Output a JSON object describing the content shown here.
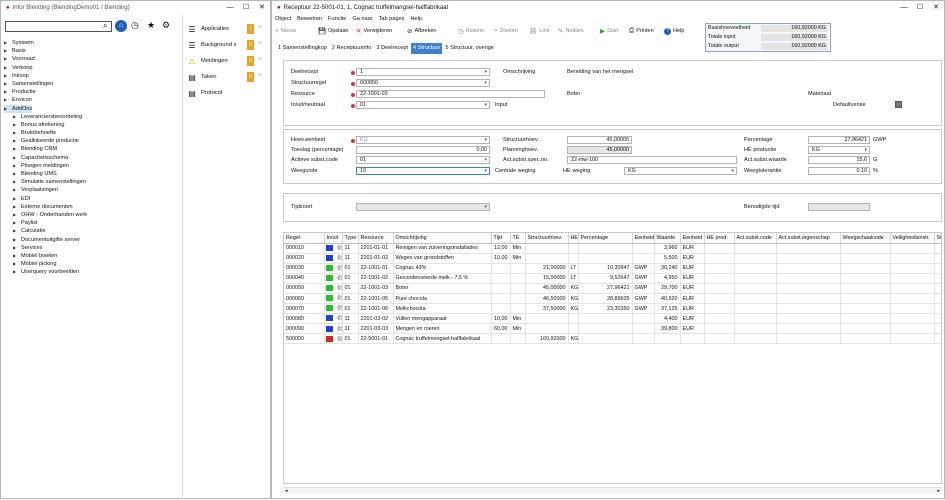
{
  "left": {
    "title": "Infor Blending (BlendingDemo01 / Blending)",
    "tree": [
      {
        "label": "Systeem",
        "level": 0,
        "sel": false
      },
      {
        "label": "Basis",
        "level": 0,
        "sel": false
      },
      {
        "label": "Voorraad",
        "level": 0,
        "sel": false
      },
      {
        "label": "Verkoop",
        "level": 0,
        "sel": false
      },
      {
        "label": "Inkoop",
        "level": 0,
        "sel": false
      },
      {
        "label": "Samenstellingen",
        "level": 0,
        "sel": false
      },
      {
        "label": "Productie",
        "level": 0,
        "sel": false
      },
      {
        "label": "Envicon",
        "level": 0,
        "sel": false
      },
      {
        "label": "AddOns",
        "level": 0,
        "sel": true
      },
      {
        "label": "Leveranciersbeoordeling",
        "level": 1,
        "sel": false
      },
      {
        "label": "Bonus afrekening",
        "level": 1,
        "sel": false
      },
      {
        "label": "Brutobehoefte",
        "level": 1,
        "sel": false
      },
      {
        "label": "Geallokeerde productie",
        "level": 1,
        "sel": false
      },
      {
        "label": "Blending CRM",
        "level": 1,
        "sel": false
      },
      {
        "label": "Capaciteitsschema",
        "level": 1,
        "sel": false
      },
      {
        "label": "Ploegen meldingen",
        "level": 1,
        "sel": false
      },
      {
        "label": "Blending UMS",
        "level": 1,
        "sel": false
      },
      {
        "label": "Simulatie samenstellingen",
        "level": 1,
        "sel": false
      },
      {
        "label": "Verplaatsingen",
        "level": 1,
        "sel": false
      },
      {
        "label": "EDI",
        "level": 1,
        "sel": false
      },
      {
        "label": "Externe documenten",
        "level": 1,
        "sel": false
      },
      {
        "label": "OHW - Onderhanden werk",
        "level": 1,
        "sel": false
      },
      {
        "label": "Paylist",
        "level": 1,
        "sel": false
      },
      {
        "label": "Calculatie",
        "level": 1,
        "sel": false
      },
      {
        "label": "Documentuitgifte server",
        "level": 1,
        "sel": false
      },
      {
        "label": "Services",
        "level": 1,
        "sel": false
      },
      {
        "label": "Mobiel boeken",
        "level": 1,
        "sel": false
      },
      {
        "label": "Mobiel picking",
        "level": 1,
        "sel": false
      },
      {
        "label": "Userquery voorbeelden",
        "level": 1,
        "sel": false
      }
    ],
    "panel": [
      {
        "label": "Applicaties",
        "count": "1",
        "icon": "list-icon"
      },
      {
        "label": "Background s",
        "count": "0",
        "icon": "list-icon"
      },
      {
        "label": "Meldingen",
        "count": "0",
        "icon": "warning-icon"
      },
      {
        "label": "Taken",
        "count": "0",
        "icon": "clipboard-icon"
      },
      {
        "label": "Protocol",
        "count": "",
        "icon": "clipboard-icon"
      }
    ]
  },
  "main": {
    "title": "Receptuur 22-5001-01, 1, Cognac truffelmangsel-halffabrikaat",
    "menu": [
      "Object",
      "Bewerken",
      "Functie",
      "Ga naar",
      "Tab pages",
      "Help"
    ],
    "toolbar": [
      {
        "label": "Nieuw",
        "icon": "+"
      },
      {
        "label": "Opslaan",
        "icon": "💾"
      },
      {
        "label": "Verwijderen",
        "icon": "✕"
      },
      {
        "label": "Afbreken",
        "icon": "⊘"
      },
      {
        "label": "Historie",
        "icon": "◷"
      },
      {
        "label": "Zoeken",
        "icon": "⌕"
      },
      {
        "label": "Link",
        "icon": "⛓"
      },
      {
        "label": "Notities",
        "icon": "✎"
      },
      {
        "label": "Start",
        "icon": "▶"
      },
      {
        "label": "Printen",
        "icon": "⎙"
      },
      {
        "label": "Help",
        "icon": "?"
      }
    ],
    "summary": [
      {
        "label": "Basishoeveelheid",
        "value": "160,92000 KG"
      },
      {
        "label": "Totale input",
        "value": "160,92000 KG"
      },
      {
        "label": "Totale output",
        "value": "160,92000 KG"
      }
    ],
    "tabs": [
      "1 Samenstellingkop",
      "2 Receptuurinfo",
      "3 Deelrecept",
      "4 Structuur",
      "5 Structuur, overige"
    ],
    "active_tab": "4 Structuur",
    "form1": {
      "deelrecept_label": "Deelrecept",
      "deelrecept": "1",
      "structuurregel_label": "Structuurregel",
      "structuurregel": "000050",
      "resource_label": "Resource",
      "resource": "22-1001-03",
      "inuit_label": "In/uit/neutraal",
      "inuit": "01",
      "inuit_text": "Input",
      "omschrijving_label": "Omschrijving",
      "omschrijving": "Bereiding van het mengsel",
      "boter": "Boter",
      "materiaal": "Materiaal",
      "defaultversie": "Defaultversie"
    },
    "form2": {
      "hoev_eenheid_label": "Hoev.eenheid",
      "hoev_eenheid": "KG",
      "toeslag_label": "Toeslag (percentage)",
      "toeslag": "0,00",
      "actieve_label": "Actieve subst.code",
      "actieve": "01",
      "weegcode_label": "Weegcode",
      "weegcode": "10",
      "structuurhoev_label": "Structuurhoev.",
      "structuurhoev": "45,00000",
      "planninghoev_label": "Planninghoev.",
      "planninghoev": "45,00000",
      "actsubst_label": "Act.subst.spec.no.",
      "actsubst": "22-mw-100",
      "centrale_label": "Centrale weging",
      "he_weging_label": "HE weging",
      "he_weging": "KG",
      "percentage_label": "Percentage",
      "percentage": "27,96421",
      "percentage_unit": "GWP",
      "he_productie_label": "HE productie",
      "he_productie": "KG",
      "actwaarde_label": "Act.subst.waarde",
      "actwaarde": "15,6",
      "actwaarde_unit": "G",
      "weegtol_label": "Weegtolerantie",
      "weegtol": "0,10",
      "weegtol_unit": "%"
    },
    "form3": {
      "tijdsoort_label": "Tijdsoort",
      "benodigde_label": "Benodigde tijd"
    },
    "table": {
      "headers": [
        "Regel",
        "In/uit",
        "Type",
        "Resource",
        "Omschrijving",
        "Tijd",
        "TE",
        "Structuurhoev.",
        "HE",
        "Percentage",
        "Eenheid",
        "Waarde",
        "Eenheid",
        "HE prod.",
        "Act.subst.code",
        "Act.subst.eigenschap",
        "Weegschaalcode",
        "Veiligheidsinstr.",
        "SO"
      ],
      "rows": [
        {
          "color": "#1f3fd6",
          "cells": [
            "000010",
            "01",
            "11",
            "2201-01-01",
            "Reinigen van zuiveringsinstallaties",
            "12,00",
            "Min",
            "",
            "",
            "",
            "",
            "3,960",
            "EUR",
            "",
            "",
            "",
            "",
            "",
            ""
          ]
        },
        {
          "color": "#1f3fd6",
          "cells": [
            "000020",
            "01",
            "11",
            "2201-01-02",
            "Wegen van grondstoffen",
            "10,00",
            "Min",
            "",
            "",
            "",
            "",
            "5,500",
            "EUR",
            "",
            "",
            "",
            "",
            "",
            ""
          ]
        },
        {
          "color": "#22c22a",
          "cells": [
            "000030",
            "01",
            "01",
            "22-1001-01",
            "Cognac 43%",
            "",
            "",
            "21,00000",
            "LT",
            "10,30947",
            "GWP",
            "30,240",
            "EUR",
            "",
            "",
            "",
            "",
            "",
            ""
          ]
        },
        {
          "color": "#22c22a",
          "cells": [
            "000040",
            "01",
            "01",
            "22-1001-02",
            "Gecondenseerde melk - 7,5 %",
            "",
            "",
            "15,00000",
            "LT",
            "9,52647",
            "GWP",
            "4,950",
            "EUR",
            "",
            "",
            "",
            "",
            "",
            ""
          ]
        },
        {
          "color": "#22c22a",
          "cells": [
            "000050",
            "01",
            "01",
            "22-1001-03",
            "Boter",
            "",
            "",
            "45,00000",
            "KG",
            "27,96421",
            "GWP",
            "29,700",
            "EUR",
            "",
            "",
            "",
            "",
            "",
            ""
          ]
        },
        {
          "color": "#22c22a",
          "cells": [
            "000060",
            "01",
            "01",
            "22-1001-05",
            "Pure chocola",
            "",
            "",
            "46,50000",
            "KG",
            "28,89635",
            "GWP",
            "40,920",
            "EUR",
            "",
            "",
            "",
            "",
            "",
            ""
          ]
        },
        {
          "color": "#22c22a",
          "cells": [
            "000070",
            "01",
            "01",
            "22-1001-06",
            "Melkchocola",
            "",
            "",
            "37,50000",
            "KG",
            "23,30350",
            "GWP",
            "37,125",
            "EUR",
            "",
            "",
            "",
            "",
            "",
            ""
          ]
        },
        {
          "color": "#1f3fd6",
          "cells": [
            "000080",
            "01",
            "11",
            "2201-03-02",
            "Vullen mengapparaat",
            "10,00",
            "Min",
            "",
            "",
            "",
            "",
            "4,400",
            "EUR",
            "",
            "",
            "",
            "",
            "",
            ""
          ]
        },
        {
          "color": "#1f3fd6",
          "cells": [
            "000090",
            "01",
            "11",
            "2201-03-03",
            "Mengen en roeren",
            "60,00",
            "Min",
            "",
            "",
            "",
            "",
            "39,800",
            "EUR",
            "",
            "",
            "",
            "",
            "",
            ""
          ]
        },
        {
          "color": "#e02020",
          "cells": [
            "500000",
            "02",
            "01",
            "22-5001-01",
            "Cognac truffelmengsel-halffabrikaat",
            "",
            "",
            "160,92000",
            "KG",
            "",
            "",
            "",
            "",
            "",
            "",
            "",
            "",
            "",
            ""
          ]
        }
      ]
    }
  }
}
